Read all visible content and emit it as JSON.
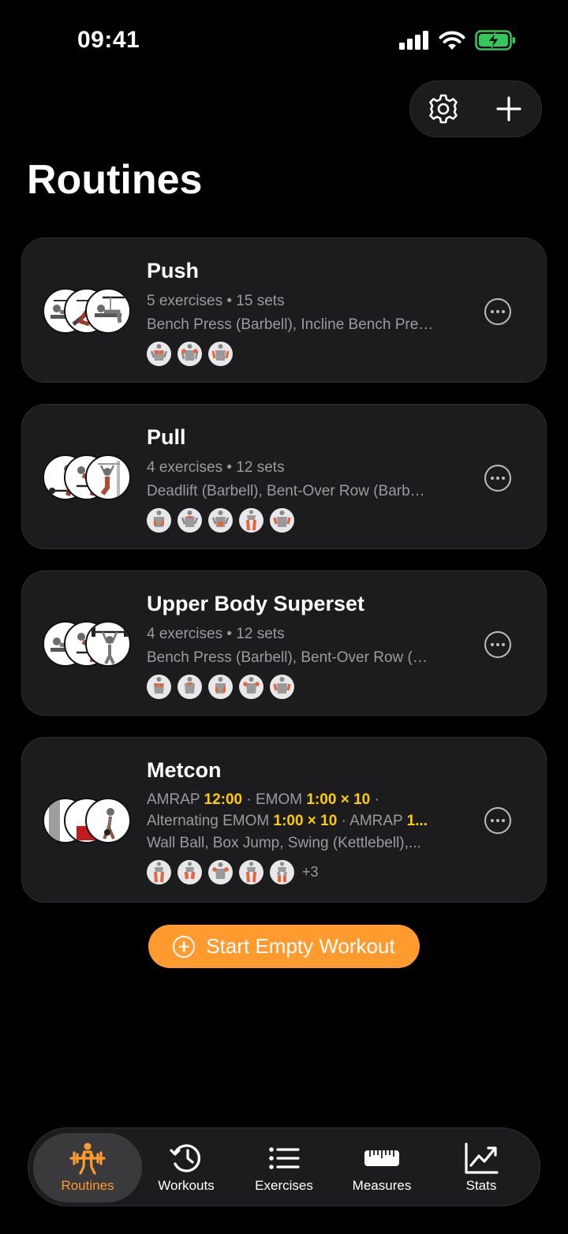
{
  "status_bar": {
    "time": "09:41"
  },
  "page": {
    "title": "Routines"
  },
  "routines": [
    {
      "name": "Push",
      "summary": "5 exercises • 15 sets",
      "exercises": "Bench Press (Barbell), Incline Bench Pre…",
      "muscle_count": 3
    },
    {
      "name": "Pull",
      "summary": "4 exercises • 12 sets",
      "exercises": "Deadlift (Barbell), Bent-Over Row (Barb…",
      "muscle_count": 5
    },
    {
      "name": "Upper Body Superset",
      "summary": "4 exercises • 12 sets",
      "exercises": "Bench Press (Barbell), Bent-Over Row (…",
      "muscle_count": 5
    },
    {
      "name": "Metcon",
      "line1": {
        "a": "AMRAP ",
        "a_val": "12:00",
        "b": " · EMOM ",
        "b_val": "1:00 × 10",
        "c": " ·"
      },
      "line2": {
        "a": "Alternating EMOM ",
        "a_val": "1:00 × 10",
        "b": " · AMRAP ",
        "b_val": "1..."
      },
      "exercises": "Wall Ball, Box Jump, Swing (Kettlebell),...",
      "muscle_count": 5,
      "extra_muscles": "+3"
    }
  ],
  "start_button": {
    "label": "Start Empty Workout"
  },
  "tabs": [
    {
      "label": "Routines",
      "icon": "weightlifter-icon",
      "active": true
    },
    {
      "label": "Workouts",
      "icon": "history-icon",
      "active": false
    },
    {
      "label": "Exercises",
      "icon": "list-icon",
      "active": false
    },
    {
      "label": "Measures",
      "icon": "ruler-icon",
      "active": false
    },
    {
      "label": "Stats",
      "icon": "chart-icon",
      "active": false
    }
  ],
  "colors": {
    "accent": "#ff9a2f",
    "highlight": "#ffcc00",
    "card": "#1c1c1e",
    "muscle_active": "#e2673b",
    "battery": "#34c759"
  }
}
